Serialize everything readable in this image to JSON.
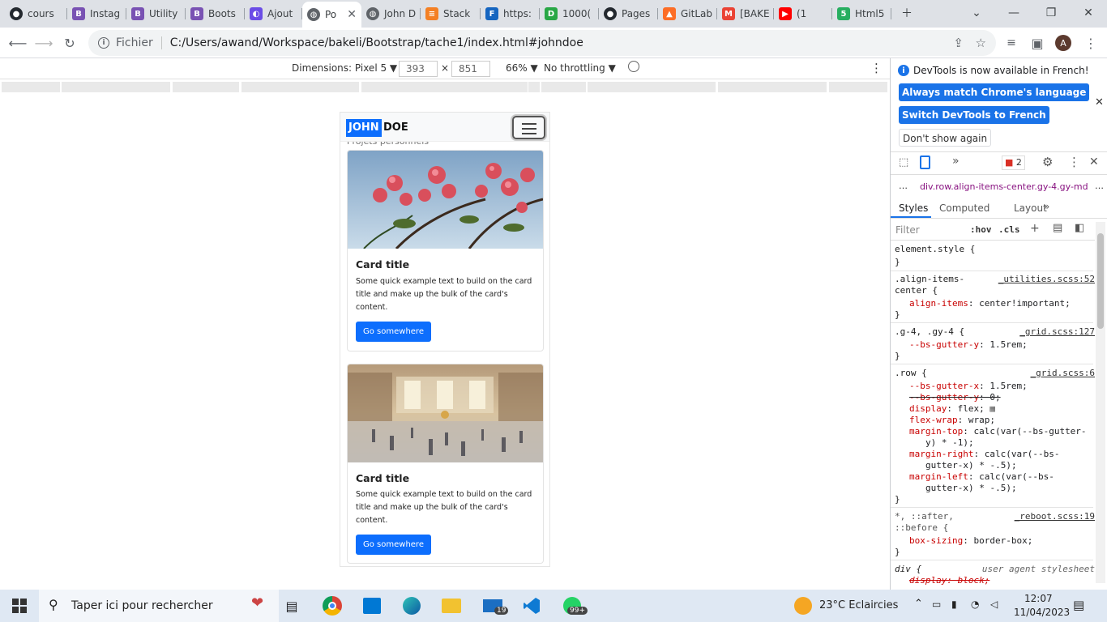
{
  "tabs": [
    {
      "label": "cours",
      "icon": "github-icon"
    },
    {
      "label": "Instag",
      "icon": "bootstrap-icon"
    },
    {
      "label": "Utility",
      "icon": "bootstrap-icon"
    },
    {
      "label": "Boots",
      "icon": "bootstrap-icon"
    },
    {
      "label": "Ajout",
      "icon": "crescent-icon"
    },
    {
      "label": "Po",
      "icon": "globe-icon",
      "active": true
    },
    {
      "label": "John D",
      "icon": "globe-icon"
    },
    {
      "label": "Stack",
      "icon": "stackoverflow-icon"
    },
    {
      "label": "https:",
      "icon": "f-icon"
    },
    {
      "label": "1000(",
      "icon": "d-icon"
    },
    {
      "label": "Pages",
      "icon": "github-icon"
    },
    {
      "label": "GitLab",
      "icon": "gitlab-icon"
    },
    {
      "label": "[BAKE",
      "icon": "gmail-icon"
    },
    {
      "label": "(1",
      "icon": "youtube-icon"
    },
    {
      "label": "Html5",
      "icon": "html5-icon"
    }
  ],
  "omnibox": {
    "scheme_label": "Fichier",
    "url": "C:/Users/awand/Workspace/bakeli/Bootstrap/tache1/index.html#johndoe"
  },
  "profile_initial": "A",
  "device_toolbar": {
    "dimensions_label": "Dimensions: Pixel 5 ▼",
    "width": "393",
    "times": "×",
    "height": "851",
    "zoom": "66% ▼",
    "throttling": "No throttling ▼"
  },
  "page": {
    "brand_highlight": "JOHN",
    "brand_rest": "DOE",
    "peek_text": "Projets personnels",
    "cards": [
      {
        "title": "Card title",
        "text": "Some quick example text to build on the card title and make up the bulk of the card's content.",
        "button": "Go somewhere"
      },
      {
        "title": "Card title",
        "text": "Some quick example text to build on the card title and make up the bulk of the card's content.",
        "button": "Go somewhere"
      }
    ]
  },
  "devtools": {
    "info_text": "DevTools is now available in French!",
    "btn_match": "Always match Chrome's language",
    "btn_switch": "Switch DevTools to French",
    "btn_dont": "Don't show again",
    "issues_count": "2",
    "breadcrumb": "div.row.align-items-center.gy-4.gy-md",
    "panel_tabs": [
      "Styles",
      "Computed",
      "Layout"
    ],
    "filter_placeholder": "Filter",
    "hov": ":hov",
    "cls": ".cls",
    "rules": {
      "r1_sel": "element.style {",
      "r1_end": "}",
      "r2_sel1": ".align-items-",
      "r2_sel2": "center {",
      "r2_src": "_utilities.scss:52",
      "r2_p1": "align-items",
      "r2_v1": ": center!important;",
      "r2_end": "}",
      "r3_sel": ".g-4, .gy-4 {",
      "r3_src": "_grid.scss:127",
      "r3_p1": "--bs-gutter-y",
      "r3_v1": ": 1.5rem;",
      "r3_end": "}",
      "r4_sel": ".row {",
      "r4_src": "_grid.scss:6",
      "r4_p1": "--bs-gutter-x",
      "r4_v1": ": 1.5rem;",
      "r4_p2": "--bs-gutter-y",
      "r4_v2": ": 0;",
      "r4_p3": "display",
      "r4_v3": ": flex;",
      "r4_p4": "flex-wrap",
      "r4_v4": ": wrap;",
      "r4_p5": "margin-top",
      "r4_v5": ": calc(var(--bs-gutter-",
      "r4_v5b": "y) * -1);",
      "r4_p6": "margin-right",
      "r4_v6": ": calc(var(--bs-",
      "r4_v6b": "gutter-x) * -.5);",
      "r4_p7": "margin-left",
      "r4_v7": ": calc(var(--bs-",
      "r4_v7b": "gutter-x) * -.5);",
      "r4_end": "}",
      "r5_sel1": "*, ::after,",
      "r5_sel2": "::before {",
      "r5_src": "_reboot.scss:19",
      "r5_p1": "box-sizing",
      "r5_v1": ": border-box;",
      "r5_end": "}",
      "r6_sel": "div {",
      "r6_src": "user agent stylesheet",
      "r6_p1": "display: block;"
    }
  },
  "taskbar": {
    "search_placeholder": "Taper ici pour rechercher",
    "weather": "23°C  Eclaircies",
    "time": "12:07",
    "date": "11/04/2023",
    "mail_badge": "19",
    "whatsapp_badge": "99+"
  }
}
